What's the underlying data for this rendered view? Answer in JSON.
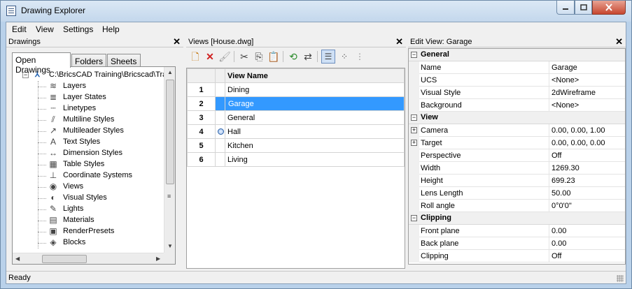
{
  "window": {
    "title": "Drawing Explorer"
  },
  "menu": [
    "Edit",
    "View",
    "Settings",
    "Help"
  ],
  "left_panel": {
    "title": "Drawings",
    "tabs": [
      "Open Drawings",
      "Folders",
      "Sheets"
    ],
    "active_tab": "Open Drawings",
    "root": "C:\\BricsCAD Training\\Bricscad\\Tra",
    "items": [
      {
        "label": "Layers",
        "icon": "layers-icon"
      },
      {
        "label": "Layer States",
        "icon": "layer-states-icon"
      },
      {
        "label": "Linetypes",
        "icon": "linetypes-icon"
      },
      {
        "label": "Multiline Styles",
        "icon": "multiline-styles-icon"
      },
      {
        "label": "Multileader Styles",
        "icon": "multileader-styles-icon"
      },
      {
        "label": "Text Styles",
        "icon": "text-styles-icon"
      },
      {
        "label": "Dimension Styles",
        "icon": "dimension-styles-icon"
      },
      {
        "label": "Table Styles",
        "icon": "table-styles-icon"
      },
      {
        "label": "Coordinate Systems",
        "icon": "coordinate-systems-icon"
      },
      {
        "label": "Views",
        "icon": "views-icon"
      },
      {
        "label": "Visual Styles",
        "icon": "visual-styles-icon"
      },
      {
        "label": "Lights",
        "icon": "lights-icon"
      },
      {
        "label": "Materials",
        "icon": "materials-icon"
      },
      {
        "label": "RenderPresets",
        "icon": "render-presets-icon"
      },
      {
        "label": "Blocks",
        "icon": "blocks-icon"
      }
    ]
  },
  "middle_panel": {
    "title": "Views [House.dwg]",
    "column_header": "View Name",
    "rows": [
      {
        "num": "1",
        "name": "Dining"
      },
      {
        "num": "2",
        "name": "Garage"
      },
      {
        "num": "3",
        "name": "General"
      },
      {
        "num": "4",
        "name": "Hall"
      },
      {
        "num": "5",
        "name": "Kitchen"
      },
      {
        "num": "6",
        "name": "Living"
      }
    ],
    "selected_row": "2",
    "active_marker_row": "4"
  },
  "right_panel": {
    "title": "Edit View: Garage",
    "rows": [
      {
        "type": "cat",
        "label": "General"
      },
      {
        "type": "prop",
        "label": "Name",
        "value": "Garage"
      },
      {
        "type": "prop",
        "label": "UCS",
        "value": "<None>"
      },
      {
        "type": "prop",
        "label": "Visual Style",
        "value": "2dWireframe"
      },
      {
        "type": "prop",
        "label": "Background",
        "value": "<None>"
      },
      {
        "type": "cat",
        "label": "View"
      },
      {
        "type": "prop",
        "label": "Camera",
        "value": "0.00, 0.00, 1.00",
        "expandable": true
      },
      {
        "type": "prop",
        "label": "Target",
        "value": "0.00, 0.00, 0.00",
        "expandable": true
      },
      {
        "type": "prop",
        "label": "Perspective",
        "value": "Off"
      },
      {
        "type": "prop",
        "label": "Width",
        "value": "1269.30"
      },
      {
        "type": "prop",
        "label": "Height",
        "value": "699.23"
      },
      {
        "type": "prop",
        "label": "Lens Length",
        "value": "50.00"
      },
      {
        "type": "prop",
        "label": "Roll angle",
        "value": "0°0'0\""
      },
      {
        "type": "cat",
        "label": "Clipping"
      },
      {
        "type": "prop",
        "label": "Front plane",
        "value": "0.00"
      },
      {
        "type": "prop",
        "label": "Back plane",
        "value": "0.00"
      },
      {
        "type": "prop",
        "label": "Clipping",
        "value": "Off"
      }
    ]
  },
  "status": {
    "text": "Ready"
  },
  "colors": {
    "selection": "#3399ff",
    "titlebar": "#c3d7ec",
    "close_button": "#c7472f"
  }
}
